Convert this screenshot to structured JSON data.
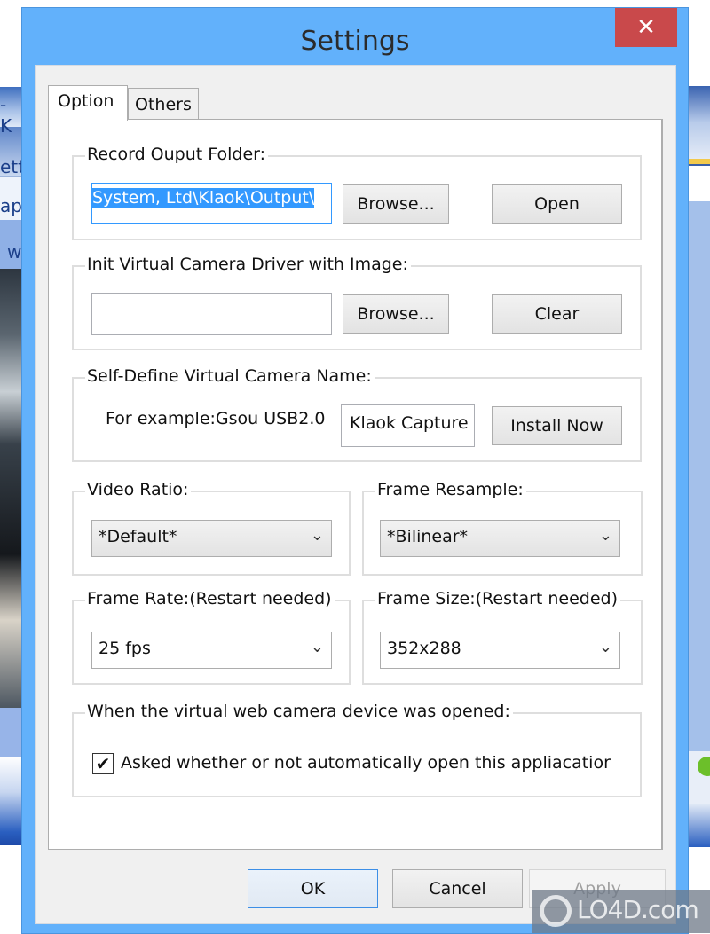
{
  "background": {
    "left_fragments": [
      "- K",
      "ett",
      "ap",
      "w"
    ]
  },
  "window": {
    "title": "Settings",
    "close_icon": "close-icon",
    "close_glyph": "✕"
  },
  "tabs": [
    {
      "label": "Option",
      "active": true
    },
    {
      "label": "Others",
      "active": false
    }
  ],
  "option": {
    "record_output": {
      "label": "Record Ouput Folder:",
      "path_value": "System, Ltd\\Klaok\\Output\\",
      "browse_label": "Browse...",
      "open_label": "Open"
    },
    "init_image": {
      "label": "Init Virtual Camera Driver with Image:",
      "path_value": "",
      "browse_label": "Browse...",
      "clear_label": "Clear"
    },
    "camera_name": {
      "label": "Self-Define Virtual Camera Name:",
      "example_text": "For example:Gsou USB2.0",
      "name_value": "Klaok Capture",
      "install_label": "Install Now"
    },
    "video_ratio": {
      "label": "Video Ratio:",
      "selected": "*Default*"
    },
    "frame_resample": {
      "label": "Frame Resample:",
      "selected": "*Bilinear*"
    },
    "frame_rate": {
      "label": "Frame Rate:(Restart needed)",
      "selected": "25 fps"
    },
    "frame_size": {
      "label": "Frame Size:(Restart needed)",
      "selected": "352x288"
    },
    "on_open": {
      "label": "When the virtual web camera device was opened:",
      "checkbox_label": "Asked whether or not automatically open this appliacatior",
      "checked": true,
      "check_glyph": "✔"
    },
    "chevron_glyph": "⌄"
  },
  "footer": {
    "ok_label": "OK",
    "cancel_label": "Cancel",
    "apply_label": "Apply"
  },
  "watermark": {
    "text": "LO4D.com"
  }
}
